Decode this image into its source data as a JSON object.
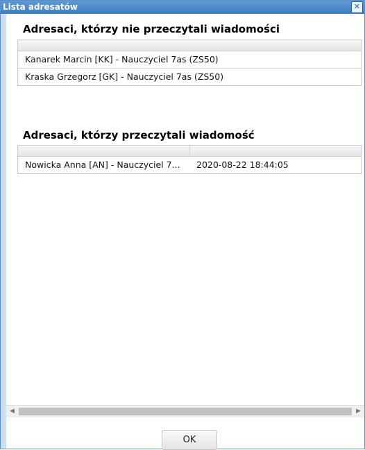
{
  "window": {
    "title": "Lista adresatów",
    "close_symbol": "✕"
  },
  "unread": {
    "heading": "Adresaci, którzy nie przeczytali wiadomości",
    "rows": [
      "Kanarek Marcin [KK] - Nauczyciel 7as (ZS50)",
      "Kraska Grzegorz [GK] - Nauczyciel 7as (ZS50)"
    ]
  },
  "read": {
    "heading": "Adresaci, którzy przeczytali wiadomość",
    "rows": [
      {
        "name": "Nowicka Anna [AN] - Nauczyciel 7...",
        "date": "2020-08-22 18:44:05"
      }
    ]
  },
  "scrollbar": {
    "left_arrow": "◀",
    "right_arrow": "▶"
  },
  "footer": {
    "ok_label": "OK"
  }
}
